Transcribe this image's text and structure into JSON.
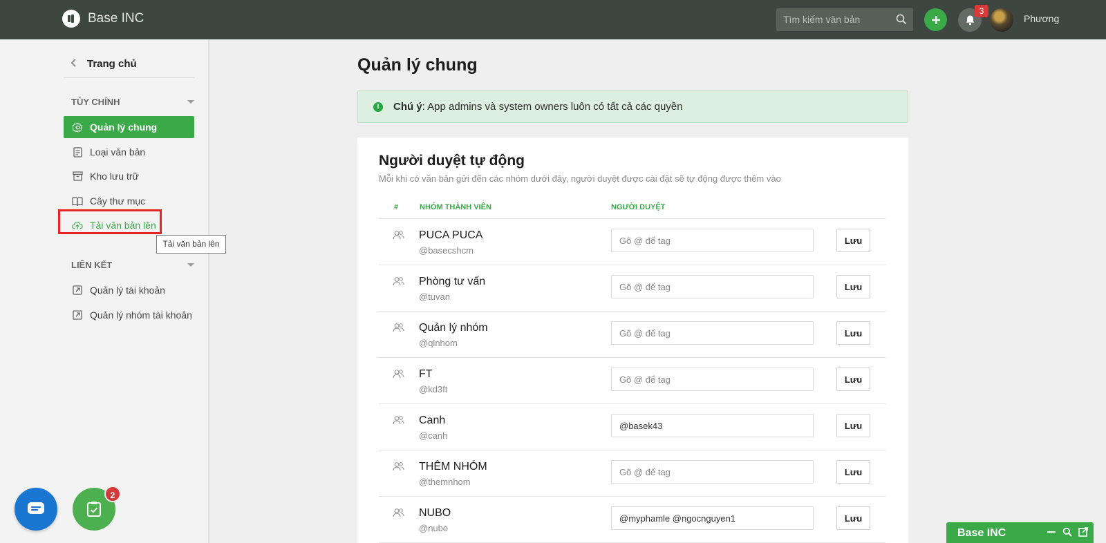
{
  "header": {
    "brand": "Base INC",
    "search_placeholder": "Tìm kiếm văn bản",
    "notification_count": "3",
    "user_name": "Phương"
  },
  "sidebar": {
    "home_label": "Trang chủ",
    "section_custom": "TÙY CHỈNH",
    "custom_items": [
      {
        "label": "Quản lý chung",
        "icon": "gear-icon"
      },
      {
        "label": "Loại văn bản",
        "icon": "document-icon"
      },
      {
        "label": "Kho lưu trữ",
        "icon": "archive-icon"
      },
      {
        "label": "Cây thư mục",
        "icon": "book-icon"
      },
      {
        "label": "Tải văn bản lên",
        "icon": "cloud-upload-icon"
      }
    ],
    "tooltip": "Tải văn bản lên",
    "section_links": "LIÊN KẾT",
    "link_items": [
      {
        "label": "Quản lý tài khoản",
        "icon": "external-link-icon"
      },
      {
        "label": "Quản lý nhóm tài khoản",
        "icon": "external-link-icon"
      }
    ]
  },
  "main": {
    "title": "Quản lý chung",
    "alert_strong": "Chú ý",
    "alert_text": ": App admins và system owners luôn có tất cả các quyền",
    "card_title": "Người duyệt tự động",
    "card_subtitle": "Mỗi khi có văn bản gửi đến các nhóm dưới đây, người duyệt được cài đặt sẽ tự động được thêm vào",
    "columns": [
      "#",
      "NHÓM THÀNH VIÊN",
      "NGƯỜI DUYỆT"
    ],
    "input_placeholder": "Gõ @ để tag",
    "save_label": "Lưu",
    "rows": [
      {
        "name": "PUCA PUCA",
        "handle": "@basecshcm",
        "value": ""
      },
      {
        "name": "Phòng tư vấn",
        "handle": "@tuvan",
        "value": ""
      },
      {
        "name": "Quản lý nhóm",
        "handle": "@qlnhom",
        "value": ""
      },
      {
        "name": "FT",
        "handle": "@kd3ft",
        "value": ""
      },
      {
        "name": "Canh",
        "handle": "@canh",
        "value": "@basek43"
      },
      {
        "name": "THÊM NHÓM",
        "handle": "@themnhom",
        "value": ""
      },
      {
        "name": "NUBO",
        "handle": "@nubo",
        "value": "@myphamle @ngocnguyen1"
      }
    ]
  },
  "widgets": {
    "task_badge": "2",
    "mini_title": "Base INC"
  },
  "colors": {
    "topbar": "#3d4640",
    "accent": "#3aaa48",
    "badge": "#d93a3a",
    "chat": "#1977d2"
  }
}
